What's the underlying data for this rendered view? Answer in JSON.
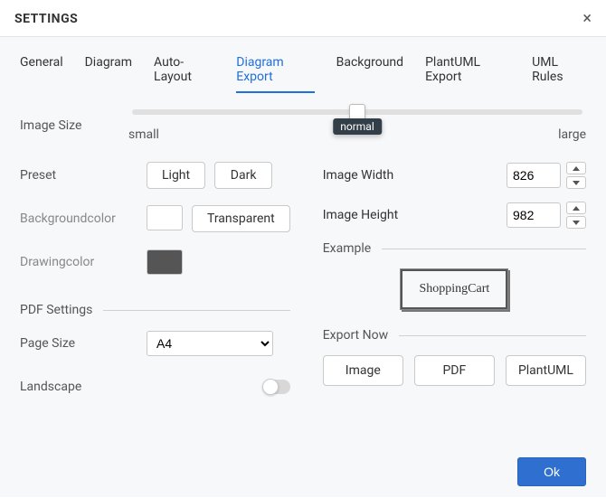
{
  "title": "SETTINGS",
  "tabs": {
    "general": "General",
    "diagram": "Diagram",
    "autolayout": "Auto-Layout",
    "diagramexport": "Diagram Export",
    "background": "Background",
    "plantumlexport": "PlantUML Export",
    "umlrules": "UML Rules"
  },
  "active_tab": "diagramexport",
  "image_size": {
    "label": "Image Size",
    "min_label": "small",
    "max_label": "large",
    "value_label": "normal"
  },
  "preset": {
    "label": "Preset",
    "light": "Light",
    "dark": "Dark"
  },
  "backgroundcolor": {
    "label": "Backgroundcolor",
    "transparent": "Transparent",
    "color": "#ffffff"
  },
  "drawingcolor": {
    "label": "Drawingcolor",
    "color": "#555555"
  },
  "pdf": {
    "section": "PDF Settings",
    "page_size_label": "Page Size",
    "page_size_value": "A4",
    "landscape_label": "Landscape",
    "landscape_on": false
  },
  "dimensions": {
    "width_label": "Image Width",
    "width_value": "826",
    "height_label": "Image Height",
    "height_value": "982"
  },
  "example": {
    "section": "Example",
    "text": "ShoppingCart"
  },
  "export": {
    "section": "Export Now",
    "image": "Image",
    "pdf": "PDF",
    "plantuml": "PlantUML"
  },
  "footer": {
    "ok": "Ok"
  }
}
